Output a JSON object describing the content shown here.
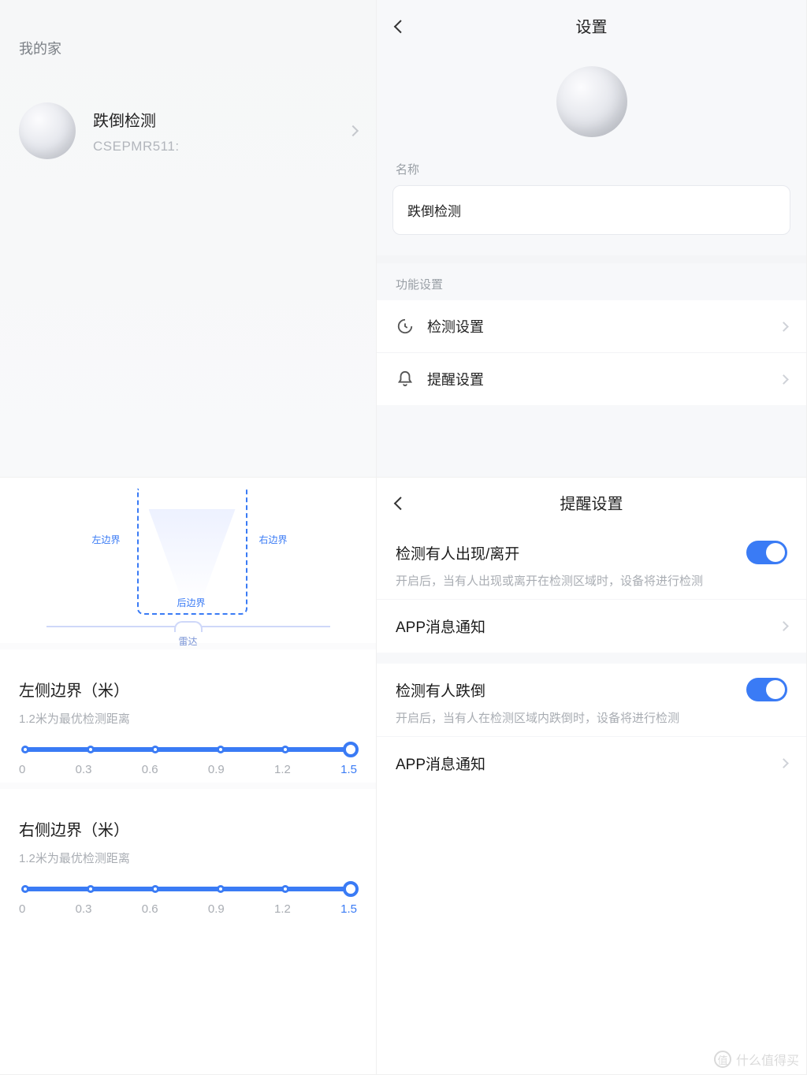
{
  "topLeft": {
    "header": "我的家",
    "device": {
      "name": "跌倒检测",
      "sub": "CSEPMR511:"
    }
  },
  "topRight": {
    "title": "设置",
    "nameLabel": "名称",
    "nameValue": "跌倒检测",
    "funcLabel": "功能设置",
    "rows": [
      {
        "label": "检测设置"
      },
      {
        "label": "提醒设置"
      }
    ]
  },
  "bottomLeft": {
    "diagram": {
      "left": "左边界",
      "right": "右边界",
      "back": "后边界",
      "radar": "雷达"
    },
    "sliders": [
      {
        "title": "左侧边界（米）",
        "sub": "1.2米为最优检测距离",
        "ticks": [
          "0",
          "0.3",
          "0.6",
          "0.9",
          "1.2",
          "1.5"
        ],
        "value": "1.5"
      },
      {
        "title": "右侧边界（米）",
        "sub": "1.2米为最优检测距离",
        "ticks": [
          "0",
          "0.3",
          "0.6",
          "0.9",
          "1.2",
          "1.5"
        ],
        "value": "1.5"
      }
    ]
  },
  "bottomRight": {
    "title": "提醒设置",
    "groups": [
      {
        "title": "检测有人出现/离开",
        "desc": "开启后，当有人出现或离开在检测区域时，设备将进行检测",
        "toggle": true
      },
      {
        "title": "检测有人跌倒",
        "desc": "开启后，当有人在检测区域内跌倒时，设备将进行检测",
        "toggle": true
      }
    ],
    "linkLabel": "APP消息通知"
  },
  "watermark": "什么值得买"
}
